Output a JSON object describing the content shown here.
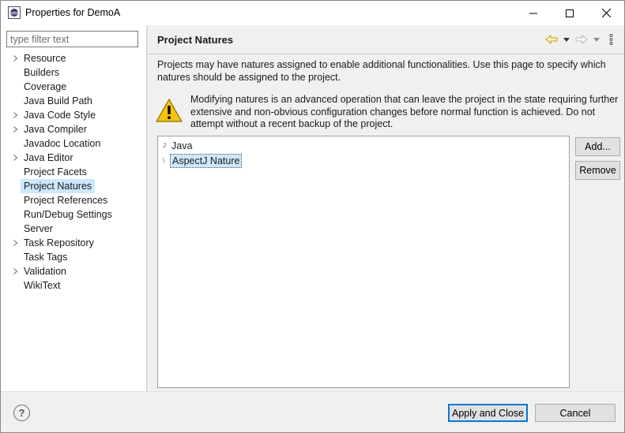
{
  "window": {
    "title": "Properties for DemoA"
  },
  "filter": {
    "placeholder": "type filter text"
  },
  "tree": {
    "items": [
      {
        "label": "Resource",
        "expandable": true
      },
      {
        "label": "Builders",
        "expandable": false
      },
      {
        "label": "Coverage",
        "expandable": false
      },
      {
        "label": "Java Build Path",
        "expandable": false
      },
      {
        "label": "Java Code Style",
        "expandable": true
      },
      {
        "label": "Java Compiler",
        "expandable": true
      },
      {
        "label": "Javadoc Location",
        "expandable": false
      },
      {
        "label": "Java Editor",
        "expandable": true
      },
      {
        "label": "Project Facets",
        "expandable": false
      },
      {
        "label": "Project Natures",
        "expandable": false,
        "selected": true
      },
      {
        "label": "Project References",
        "expandable": false
      },
      {
        "label": "Run/Debug Settings",
        "expandable": false
      },
      {
        "label": "Server",
        "expandable": false
      },
      {
        "label": "Task Repository",
        "expandable": true
      },
      {
        "label": "Task Tags",
        "expandable": false
      },
      {
        "label": "Validation",
        "expandable": true
      },
      {
        "label": "WikiText",
        "expandable": false
      }
    ]
  },
  "page": {
    "title": "Project Natures",
    "description": "Projects may have natures assigned to enable additional functionalities. Use this page to specify which natures should be assigned to the project.",
    "warning": "Modifying natures is an advanced operation that can leave the project in the state requiring further extensive and non-obvious configuration changes before normal function is achieved. Do not attempt without a recent backup of the project.",
    "natures": [
      {
        "label": "Java",
        "icon": "J",
        "selected": false
      },
      {
        "label": "AspectJ Nature",
        "icon": "\\",
        "selected": true
      }
    ],
    "add_label": "Add...",
    "remove_label": "Remove"
  },
  "footer": {
    "help_label": "?",
    "apply_close_label": "Apply and Close",
    "cancel_label": "Cancel"
  },
  "colors": {
    "selection": "#cce8ff",
    "accent": "#0078d7",
    "warning": "#f5c400"
  }
}
